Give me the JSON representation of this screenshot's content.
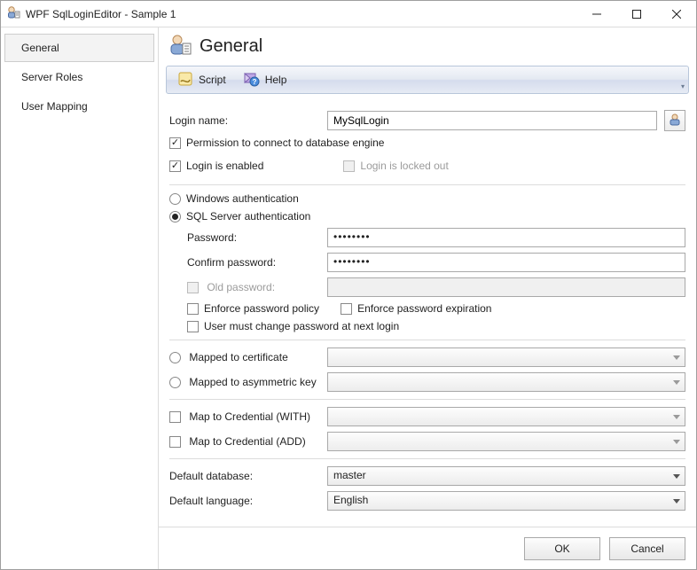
{
  "window": {
    "title": "WPF SqlLoginEditor - Sample 1"
  },
  "sidebar": {
    "items": [
      {
        "label": "General"
      },
      {
        "label": "Server Roles"
      },
      {
        "label": "User Mapping"
      }
    ]
  },
  "header": {
    "title": "General"
  },
  "toolbar": {
    "script_label": "Script",
    "help_label": "Help"
  },
  "form": {
    "login_name_label": "Login name:",
    "login_name_value": "MySqlLogin",
    "perm_connect_label": "Permission to connect to database engine",
    "login_enabled_label": "Login is enabled",
    "login_locked_label": "Login is locked out",
    "win_auth_label": "Windows authentication",
    "sql_auth_label": "SQL Server authentication",
    "password_label": "Password:",
    "password_value": "••••••••",
    "confirm_label": "Confirm password:",
    "confirm_value": "••••••••",
    "old_password_label": "Old password:",
    "old_password_value": "",
    "enforce_policy_label": "Enforce password policy",
    "enforce_expiration_label": "Enforce password expiration",
    "must_change_label": "User must change password at next login",
    "mapped_cert_label": "Mapped to certificate",
    "mapped_cert_value": "",
    "mapped_asym_label": "Mapped to asymmetric key",
    "mapped_asym_value": "",
    "map_cred_with_label": "Map to Credential (WITH)",
    "map_cred_with_value": "",
    "map_cred_add_label": "Map to Credential (ADD)",
    "map_cred_add_value": "",
    "default_db_label": "Default database:",
    "default_db_value": "master",
    "default_lang_label": "Default language:",
    "default_lang_value": "English"
  },
  "footer": {
    "ok_label": "OK",
    "cancel_label": "Cancel"
  }
}
